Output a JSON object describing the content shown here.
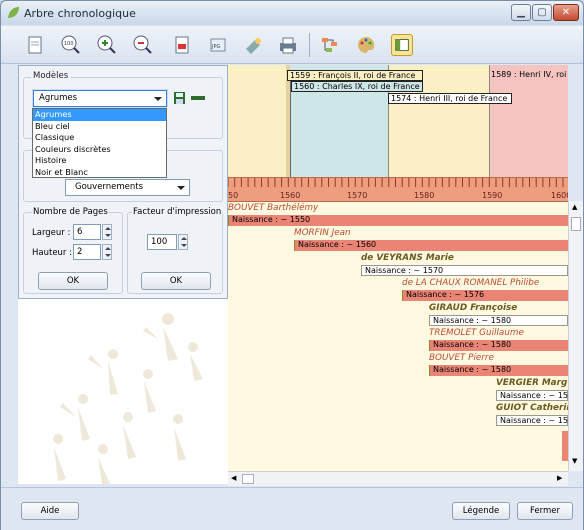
{
  "window": {
    "title": "Arbre chronologique",
    "controls": [
      "minimize-icon",
      "maximize-icon",
      "close-icon"
    ]
  },
  "toolbar": {
    "icons": [
      "page-icon",
      "zoom-100-icon",
      "zoom-in-icon",
      "zoom-out-icon",
      "pdf-icon",
      "jpg-icon",
      "paint-icon",
      "print-icon",
      "tree-layout-icon",
      "palette-icon",
      "panel-toggle-icon"
    ]
  },
  "models": {
    "title": "Modèles",
    "selected": "Agrumes",
    "options": [
      "Agrumes",
      "Bleu ciel",
      "Classique",
      "Couleurs discrètes",
      "Histoire",
      "Noir et Blanc"
    ]
  },
  "history": {
    "selected": "Gouvernements"
  },
  "pages": {
    "title": "Nombre de Pages",
    "width_label": "Largeur :",
    "width_value": "6",
    "height_label": "Hauteur :",
    "height_value": "2",
    "ok": "OK"
  },
  "print_factor": {
    "title": "Facteur d'impression",
    "value": "100",
    "ok": "OK"
  },
  "timeline": {
    "ticks": [
      "50",
      "1560",
      "1570",
      "1580",
      "1590",
      "1600"
    ],
    "reigns": [
      "1559 : François II, roi de France",
      "1560 : Charles IX, roi de France",
      "1574 : Henri III, roi de France",
      "1589 : Henri IV, roi de"
    ],
    "people": [
      {
        "name": "BOUVET Barthélémy",
        "birth": "Naissance : ~ 1550"
      },
      {
        "name": "MORFIN Jean",
        "birth": "Naissance : ~ 1560"
      },
      {
        "name": "de VEYRANS Marie",
        "birth": "Naissance : ~ 1570"
      },
      {
        "name": "de LA CHAUX ROMANEL Philibe",
        "birth": "Naissance : ~ 1576"
      },
      {
        "name": "GIRAUD Françoise",
        "birth": "Naissance : ~ 1580"
      },
      {
        "name": "TREMOLET Guillaume",
        "birth": "Naissance : ~ 1580"
      },
      {
        "name": "BOUVET Pierre",
        "birth": "Naissance : ~ 1580"
      },
      {
        "name": "VERGIER Marg",
        "birth": "Naissance : ~ 15"
      },
      {
        "name": "GUIOT Catherin",
        "birth": "Naissance : ~ 15"
      }
    ]
  },
  "footer": {
    "help": "Aide",
    "legend": "Légende",
    "close": "Fermer"
  },
  "colors": {
    "axis": "#ee9e7e",
    "reign_blue": "#cfe6e8",
    "reign_pink": "#f5c4c0",
    "reign_yellow": "#fbefc4",
    "selection": "#3399ff"
  }
}
